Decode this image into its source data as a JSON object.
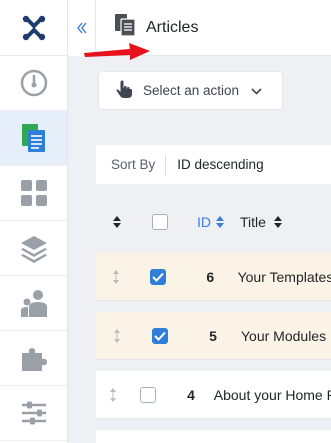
{
  "header": {
    "title": "Articles"
  },
  "toolbar": {
    "action_label": "Select an action"
  },
  "sort": {
    "label": "Sort By",
    "value": "ID descending"
  },
  "table": {
    "columns": {
      "id": "ID",
      "title": "Title"
    },
    "rows": [
      {
        "id": "6",
        "title": "Your Templates",
        "checked": true
      },
      {
        "id": "5",
        "title": "Your Modules",
        "checked": true
      },
      {
        "id": "4",
        "title": "About your Home Page",
        "checked": false
      }
    ]
  },
  "colors": {
    "accent": "#3b7ddd",
    "selected_row": "#fcf3e7",
    "arrow": "#e8101a"
  },
  "sidebar": {
    "icons": [
      "joomla-logo-icon",
      "dashboard-gauge-icon",
      "content-articles-icon",
      "menus-grid-icon",
      "components-layers-icon",
      "users-icon",
      "extensions-puzzle-icon",
      "system-sliders-icon"
    ]
  }
}
